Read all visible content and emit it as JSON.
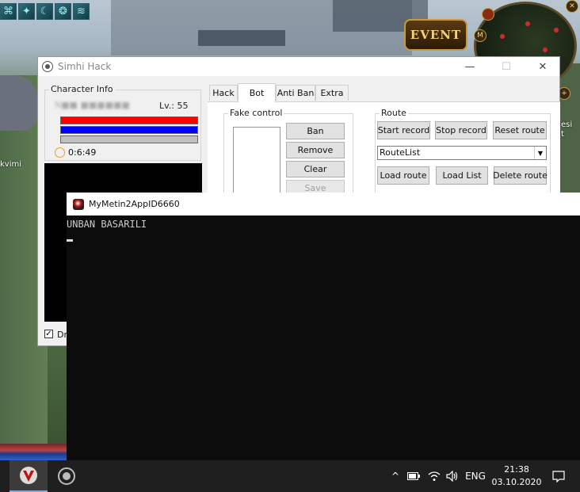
{
  "game": {
    "event_label": "EVENT",
    "skill_icons": [
      "skill-icon-1",
      "skill-icon-2",
      "skill-icon-3",
      "skill-icon-4",
      "skill-icon-5"
    ],
    "side_text_left": "kvimi",
    "side_text_right": "esi\nt",
    "minimap_buttons": [
      "M"
    ]
  },
  "hack_window": {
    "title": "Simhi Hack",
    "controls": {
      "minimize": "—",
      "maximize": "☐",
      "close": "✕"
    },
    "character_info": {
      "label": "Character Info",
      "name": "N■■  ■■■■■■",
      "level_label": "Lv.: 55",
      "hp_color": "#ff0000",
      "mp_color": "#0000ff",
      "exp_color": "#c0c0c0",
      "timer": "0:6:49"
    },
    "checkbox_label": "Dr",
    "tabs": [
      "Hack",
      "Bot",
      "Anti Ban",
      "Extra"
    ],
    "active_tab": "Bot",
    "fake_control": {
      "label": "Fake control",
      "buttons": {
        "ban": "Ban",
        "remove": "Remove",
        "clear": "Clear",
        "save": "Save"
      }
    },
    "route": {
      "label": "Route",
      "start_record": "Start record",
      "stop_record": "Stop record",
      "reset_route": "Reset route",
      "route_list_value": "RouteList",
      "load_route": "Load route",
      "load_list": "Load List",
      "delete_route": "Delete route"
    }
  },
  "console": {
    "title": "MyMetin2AppID6660",
    "output": "UNBAN BASARILI"
  },
  "taskbar": {
    "apps": [
      "metin2-app",
      "simhi-hack-app"
    ],
    "language": "ENG",
    "time": "21:38",
    "date": "03.10.2020"
  }
}
